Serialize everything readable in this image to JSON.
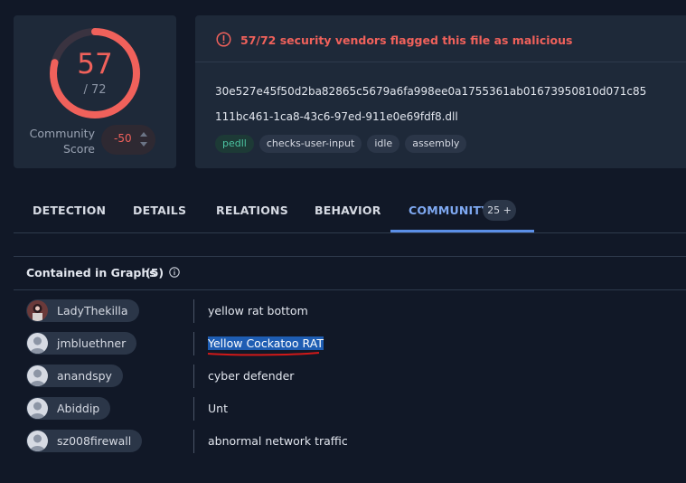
{
  "score": {
    "detections": "57",
    "total": "/ 72",
    "ratio": 0.79,
    "ring_color": "#f0615b"
  },
  "community": {
    "label_line1": "Community",
    "label_line2": "Score",
    "value": "-50"
  },
  "alert": {
    "text": "57/72 security vendors flagged this file as malicious"
  },
  "file": {
    "hash": "30e527e45f50d2ba82865c5679a6fa998ee0a1755361ab01673950810d071c85",
    "name": "111bc461-1ca8-43c6-97ed-911e0e69fdf8.dll",
    "tags": [
      "pedll",
      "checks-user-input",
      "idle",
      "assembly"
    ]
  },
  "tabs": {
    "detection": "DETECTION",
    "details": "DETAILS",
    "relations": "RELATIONS",
    "behavior": "BEHAVIOR",
    "community": "COMMUNITY",
    "community_badge": "25 +"
  },
  "graphs": {
    "title": "Contained in Graphs",
    "count": "(5)",
    "rows": [
      {
        "user": "LadyThekilla",
        "graph": "yellow rat bottom"
      },
      {
        "user": "jmbluethner",
        "graph": "Yellow Cockatoo RAT"
      },
      {
        "user": "anandspy",
        "graph": "cyber defender"
      },
      {
        "user": "Abiddip",
        "graph": "Unt"
      },
      {
        "user": "sz008firewall",
        "graph": "abnormal network traffic"
      }
    ]
  },
  "colors": {
    "accent": "#5b8fe8",
    "danger": "#f0615b",
    "tag_green": "#4cc4a2",
    "highlight": "#1e5db3"
  }
}
